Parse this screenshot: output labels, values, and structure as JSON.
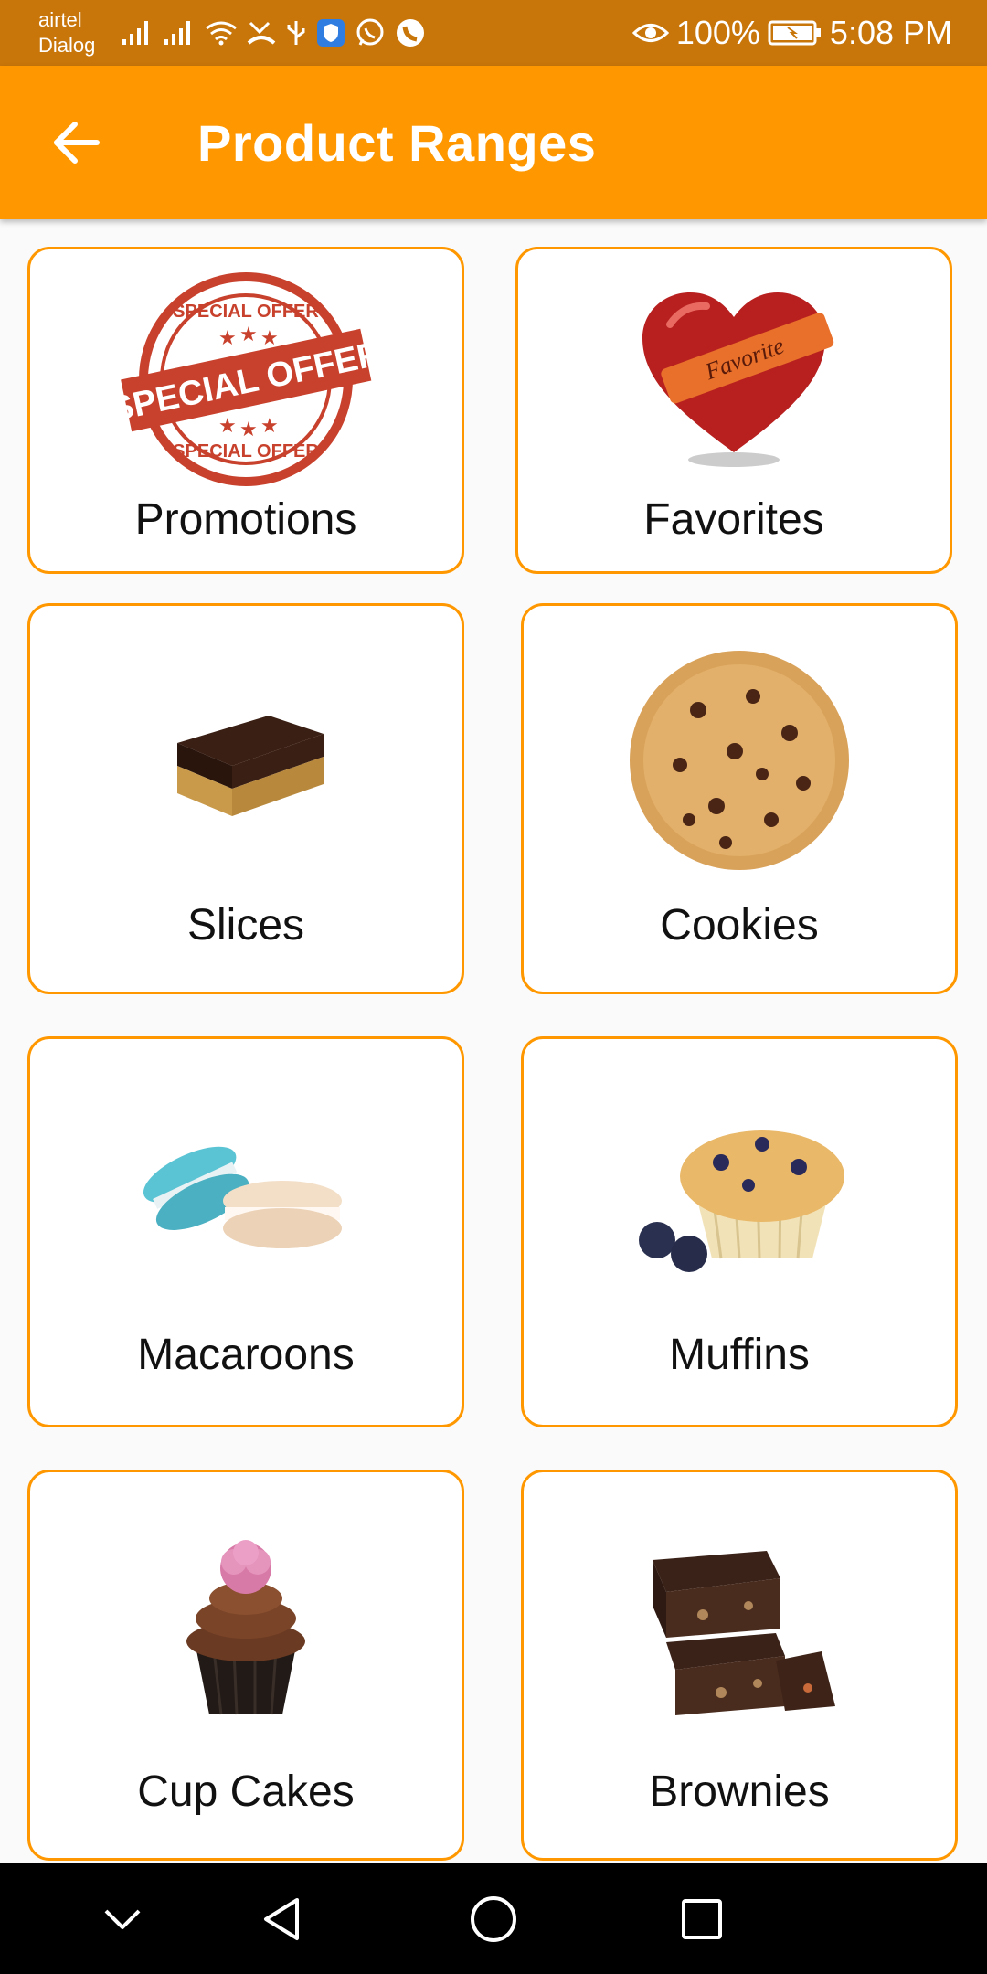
{
  "status_bar": {
    "carrier_line1": "airtel",
    "carrier_line2": "Dialog",
    "battery": "100%",
    "time": "5:08 PM",
    "icons": [
      "signal-icon",
      "signal-icon",
      "wifi-icon",
      "missed-call-icon",
      "usb-icon",
      "shield-icon",
      "whatsapp-icon",
      "phone-icon",
      "eye-icon",
      "battery-icon"
    ]
  },
  "app_bar": {
    "title": "Product Ranges",
    "back_icon": "arrow-left-icon"
  },
  "colors": {
    "accent": "#ff9800",
    "status_bar": "#c8760a",
    "card_border": "#ff9800"
  },
  "cards": [
    {
      "label": "Promotions",
      "image": "special-offer-stamp"
    },
    {
      "label": "Favorites",
      "image": "favorite-heart"
    },
    {
      "label": "Slices",
      "image": "slice-cake"
    },
    {
      "label": "Cookies",
      "image": "chocolate-chip-cookie"
    },
    {
      "label": "Macaroons",
      "image": "macaroons"
    },
    {
      "label": "Muffins",
      "image": "blueberry-muffin"
    },
    {
      "label": "Cup Cakes",
      "image": "cupcake"
    },
    {
      "label": "Brownies",
      "image": "brownies"
    }
  ],
  "nav_bar": {
    "icons": [
      "chevron-down-icon",
      "back-triangle-icon",
      "home-circle-icon",
      "recents-square-icon"
    ]
  }
}
